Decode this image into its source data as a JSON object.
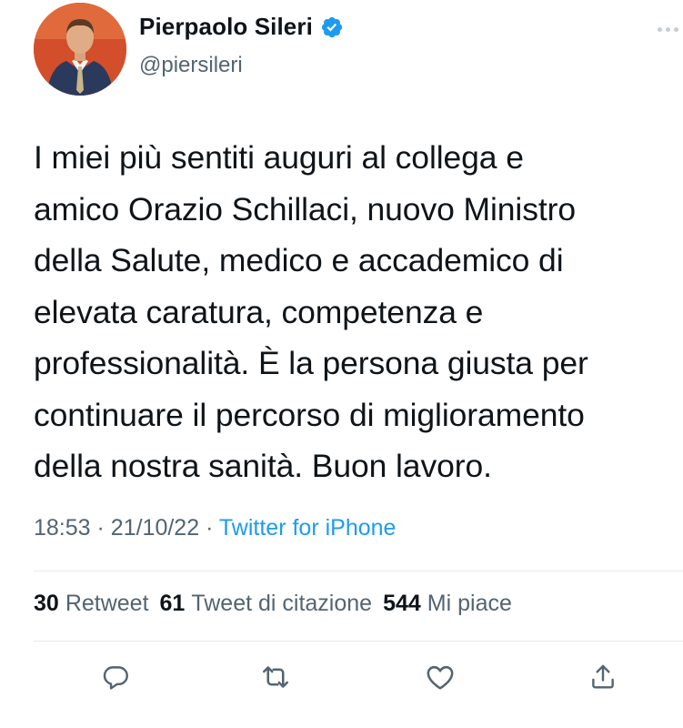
{
  "tweet": {
    "author": {
      "display_name": "Pierpaolo Sileri",
      "handle": "@piersileri",
      "verified": true
    },
    "text_lines": [
      "I miei più sentiti auguri al collega e",
      "amico Orazio Schillaci, nuovo Ministro",
      "della Salute, medico e accademico di",
      "elevata caratura, competenza e",
      "professionalità. È la persona giusta per",
      "continuare il percorso di miglioramento",
      "della nostra sanità. Buon lavoro."
    ],
    "time": "18:53",
    "date": "21/10/22",
    "separator": "·",
    "source": "Twitter for iPhone",
    "stats": {
      "retweets_count": "30",
      "retweets_label": "Retweet",
      "quotes_count": "61",
      "quotes_label": "Tweet di citazione",
      "likes_count": "544",
      "likes_label": "Mi piace"
    }
  },
  "icons": {
    "verified": "verified-badge-icon",
    "more": "more-options-icon",
    "reply": "reply-icon",
    "retweet": "retweet-icon",
    "like": "heart-icon",
    "share": "share-icon"
  },
  "colors": {
    "accent": "#1d9bf0",
    "text_primary": "#0f1419",
    "text_secondary": "#536471",
    "divider": "#e6ebee"
  }
}
